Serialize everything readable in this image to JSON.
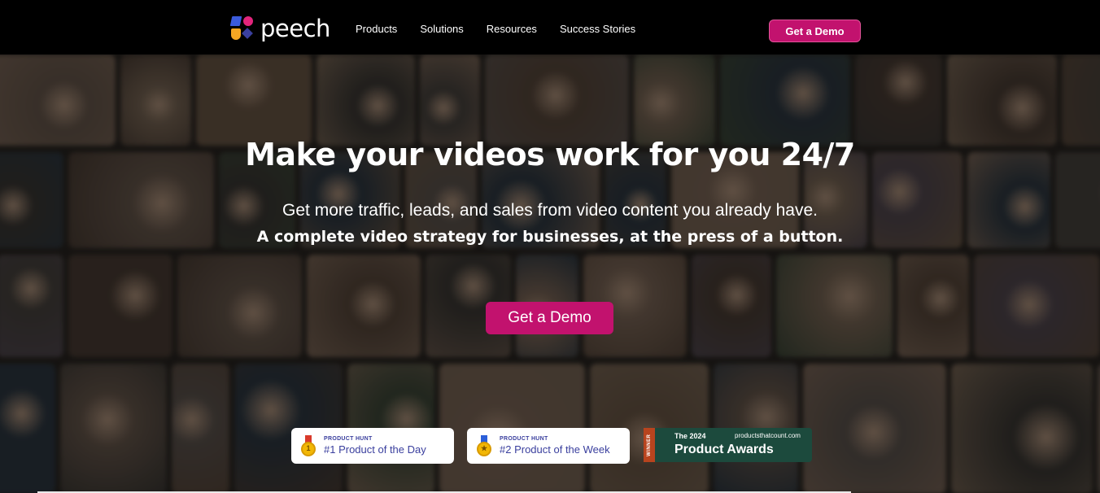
{
  "nav": {
    "logo_text": "peech",
    "links": [
      "Products",
      "Solutions",
      "Resources",
      "Success Stories"
    ],
    "cta_label": "Get a Demo"
  },
  "hero": {
    "title": "Make your videos work for you 24/7",
    "subtitle": "Get more traffic, leads, and sales from video content you already have.",
    "subtitle_bold": "A complete video strategy for businesses, at the press of a button.",
    "cta_label": "Get a Demo"
  },
  "badges": [
    {
      "kicker": "PRODUCT HUNT",
      "title": "#1 Product of the Day",
      "medal": "1"
    },
    {
      "kicker": "PRODUCT HUNT",
      "title": "#2 Product of the Week",
      "medal": "★"
    }
  ],
  "award": {
    "ribbon": "WINNER",
    "year": "The 2024",
    "site": "productsthatcount.com",
    "name": "Product Awards"
  },
  "colors": {
    "brand": "#c2126e",
    "badge_text": "#3a3f9e",
    "award_bg": "#1c4a3d"
  }
}
